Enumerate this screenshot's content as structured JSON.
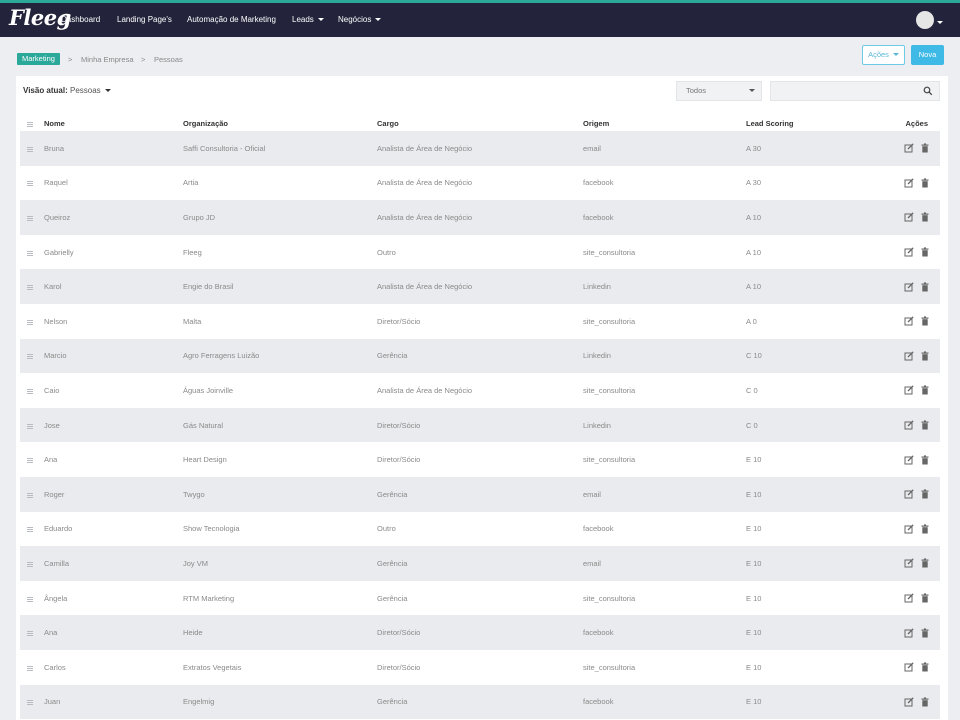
{
  "brand": {
    "logo_text": "Fleeg",
    "accent_color": "#2aa89a",
    "navbar_color": "#23243b",
    "button_color": "#3fb9e5"
  },
  "nav": {
    "items": [
      {
        "label": "Dashboard",
        "has_menu": false
      },
      {
        "label": "Landing Page's",
        "has_menu": false
      },
      {
        "label": "Automação de Marketing",
        "has_menu": false
      },
      {
        "label": "Leads",
        "has_menu": true
      },
      {
        "label": "Negócios",
        "has_menu": true
      }
    ]
  },
  "breadcrumb": {
    "items": [
      "Marketing",
      "Minha Empresa",
      "Pessoas"
    ],
    "separator": ">"
  },
  "toolbar": {
    "actions_label": "Ações",
    "new_label": "Nova"
  },
  "panel": {
    "view_label": "Visão atual:",
    "view_value": "Pessoas",
    "filter_selected": "Todos",
    "search_value": ""
  },
  "table": {
    "columns": [
      "Nome",
      "Organização",
      "Cargo",
      "Origem",
      "Lead Scoring",
      "Ações"
    ],
    "rows": [
      {
        "nome": "Bruna",
        "organizacao": "Saffi Consultoria - Oficial",
        "cargo": "Analista de Área de Negócio",
        "origem": "email",
        "lead_scoring": "A 30"
      },
      {
        "nome": "Raquel",
        "organizacao": "Artia",
        "cargo": "Analista de Área de Negócio",
        "origem": "facebook",
        "lead_scoring": "A 30"
      },
      {
        "nome": "Queiroz",
        "organizacao": "Grupo JD",
        "cargo": "Analista de Área de Negócio",
        "origem": "facebook",
        "lead_scoring": "A 10"
      },
      {
        "nome": "Gabrielly",
        "organizacao": "Fleeg",
        "cargo": "Outro",
        "origem": "site_consultoria",
        "lead_scoring": "A 10"
      },
      {
        "nome": "Karol",
        "organizacao": "Engie do Brasil",
        "cargo": "Analista de Área de Negócio",
        "origem": "Linkedin",
        "lead_scoring": "A 10"
      },
      {
        "nome": "Nelson",
        "organizacao": "Malta",
        "cargo": "Diretor/Sócio",
        "origem": "site_consultoria",
        "lead_scoring": "A 0"
      },
      {
        "nome": "Marcio",
        "organizacao": "Agro Ferragens Luizão",
        "cargo": "Gerência",
        "origem": "Linkedin",
        "lead_scoring": "C 10"
      },
      {
        "nome": "Caio",
        "organizacao": "Águas Joinville",
        "cargo": "Analista de Área de Negócio",
        "origem": "site_consultoria",
        "lead_scoring": "C 0"
      },
      {
        "nome": "Jose",
        "organizacao": "Gás Natural",
        "cargo": "Diretor/Sócio",
        "origem": "Linkedin",
        "lead_scoring": "C 0"
      },
      {
        "nome": "Ana",
        "organizacao": "Heart Design",
        "cargo": "Diretor/Sócio",
        "origem": "site_consultoria",
        "lead_scoring": "E 10"
      },
      {
        "nome": "Roger",
        "organizacao": "Twygo",
        "cargo": "Gerência",
        "origem": "email",
        "lead_scoring": "E 10"
      },
      {
        "nome": "Eduardo",
        "organizacao": "Show Tecnologia",
        "cargo": "Outro",
        "origem": "facebook",
        "lead_scoring": "E 10"
      },
      {
        "nome": "Camilla",
        "organizacao": "Joy VM",
        "cargo": "Gerência",
        "origem": "email",
        "lead_scoring": "E 10"
      },
      {
        "nome": "Ângela",
        "organizacao": "RTM Marketing",
        "cargo": "Gerência",
        "origem": "site_consultoria",
        "lead_scoring": "E 10"
      },
      {
        "nome": "Ana",
        "organizacao": "Heide",
        "cargo": "Diretor/Sócio",
        "origem": "facebook",
        "lead_scoring": "E 10"
      },
      {
        "nome": "Carlos",
        "organizacao": "Extratos Vegetais",
        "cargo": "Diretor/Sócio",
        "origem": "site_consultoria",
        "lead_scoring": "E 10"
      },
      {
        "nome": "Juan",
        "organizacao": "Engelmig",
        "cargo": "Gerência",
        "origem": "facebook",
        "lead_scoring": "E 10"
      }
    ],
    "row_actions": [
      "edit-icon",
      "trash-icon"
    ]
  }
}
